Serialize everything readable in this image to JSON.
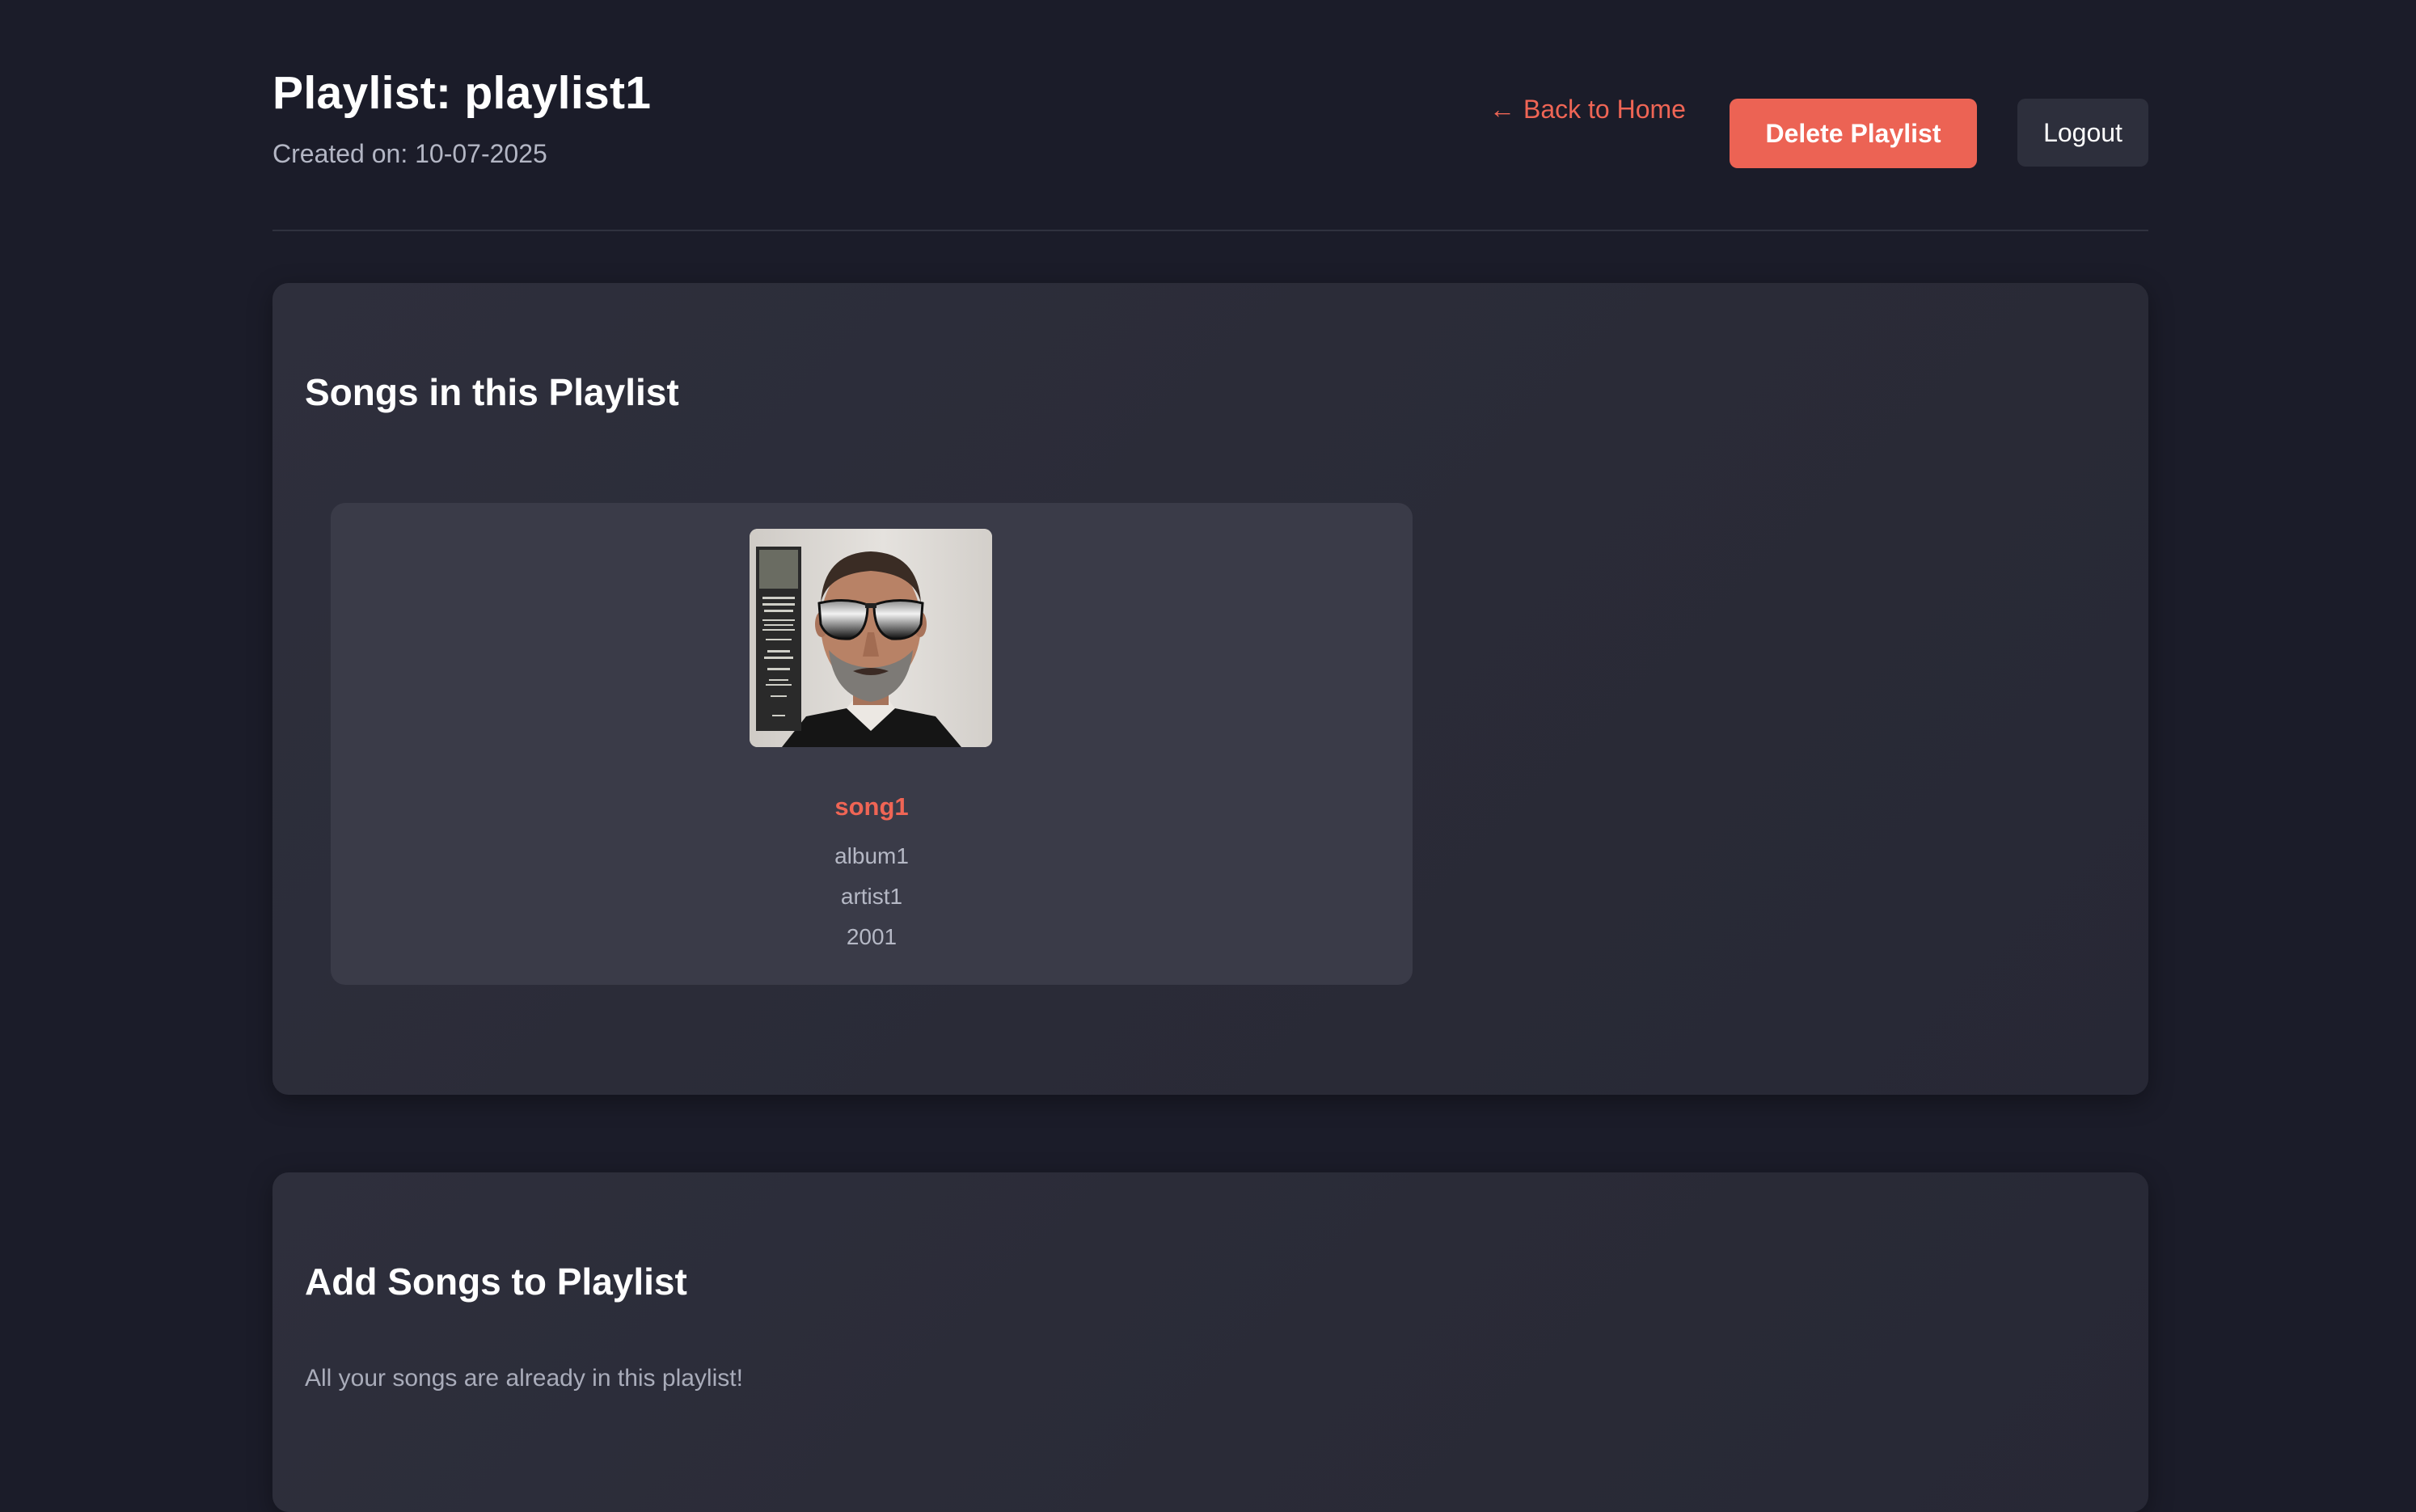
{
  "header": {
    "title": "Playlist: playlist1",
    "created_on": "Created on: 10-07-2025",
    "back_link": {
      "arrow": "←",
      "label": "Back to Home"
    },
    "delete_label": "Delete Playlist",
    "logout_label": "Logout"
  },
  "songs_section": {
    "heading": "Songs in this Playlist",
    "songs": [
      {
        "title": "song1",
        "album": "album1",
        "artist": "artist1",
        "year": "2001",
        "cover_icon": "album-cover-image"
      }
    ]
  },
  "add_section": {
    "heading": "Add Songs to Playlist",
    "empty_message": "All your songs are already in this playlist!"
  },
  "colors": {
    "background": "#1b1c29",
    "accent": "#ec6354",
    "panel": "#2e2f3c",
    "card": "#3a3b48"
  }
}
